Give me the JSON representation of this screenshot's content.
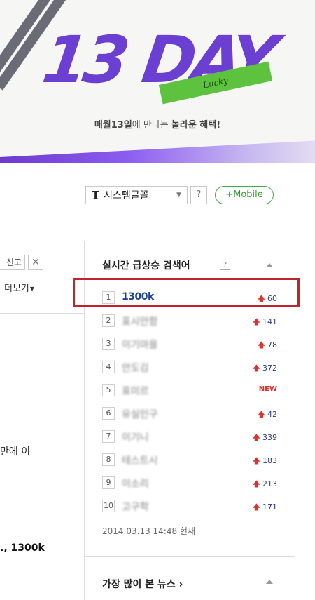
{
  "banner": {
    "title": "13 DAY",
    "ribbon_text": "Lucky",
    "tagline_bold1": "매월13일",
    "tagline_plain": "에 만나는 ",
    "tagline_bold2": "놀라운 혜택!"
  },
  "controls": {
    "font_icon": "T",
    "font_label": "시스템글꼴",
    "help_label": "?",
    "mobile_label": "+Mobile"
  },
  "article": {
    "report_label": "신고",
    "close_label": "✕",
    "more_label": "더보기",
    "fragment1": "만에 이",
    "fragment2": "., 1300k"
  },
  "trending": {
    "title": "실시간 급상승 검색어",
    "help_label": "?",
    "items": [
      {
        "rank": "1",
        "keyword": "1300k",
        "change": "60",
        "dir": "up"
      },
      {
        "rank": "2",
        "keyword": "표시안함",
        "change": "141",
        "dir": "up"
      },
      {
        "rank": "3",
        "keyword": "이기마을",
        "change": "78",
        "dir": "up"
      },
      {
        "rank": "4",
        "keyword": "안도김",
        "change": "372",
        "dir": "up"
      },
      {
        "rank": "5",
        "keyword": "표미르",
        "change": "NEW",
        "dir": "new"
      },
      {
        "rank": "6",
        "keyword": "유실인구",
        "change": "42",
        "dir": "up"
      },
      {
        "rank": "7",
        "keyword": "이기니",
        "change": "339",
        "dir": "up"
      },
      {
        "rank": "8",
        "keyword": "테스트시",
        "change": "183",
        "dir": "up"
      },
      {
        "rank": "9",
        "keyword": "이소리",
        "change": "213",
        "dir": "up"
      },
      {
        "rank": "10",
        "keyword": "고구학",
        "change": "171",
        "dir": "up"
      }
    ],
    "timestamp": "2014.03.13 14:48 현재"
  },
  "news": {
    "title": "가장 많이 본 뉴스 ›"
  },
  "colors": {
    "brand_purple": "#6a3fd1",
    "accent_green": "#3fae3f",
    "highlight_red": "#c3242b",
    "rank_up_red": "#e0312c"
  }
}
